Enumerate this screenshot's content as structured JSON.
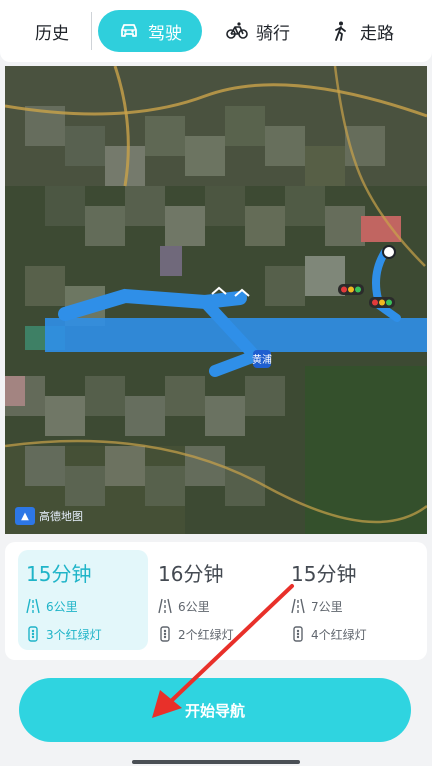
{
  "tabs": {
    "history": "历史",
    "drive": "驾驶",
    "ride": "骑行",
    "walk": "走路"
  },
  "map": {
    "logo_text": "高德地图",
    "road_label": "黄浦"
  },
  "routes": [
    {
      "time": "15分钟",
      "distance": "6公里",
      "lights": "3个红绿灯",
      "selected": true
    },
    {
      "time": "16分钟",
      "distance": "6公里",
      "lights": "2个红绿灯",
      "selected": false
    },
    {
      "time": "15分钟",
      "distance": "7公里",
      "lights": "4个红绿灯",
      "selected": false
    }
  ],
  "actions": {
    "start_navigation": "开始导航"
  },
  "colors": {
    "accent": "#2fcfdc",
    "route_line": "#2f8fe8",
    "annotation_arrow": "#e8302a"
  },
  "icons": {
    "drive": "car-icon",
    "ride": "bicycle-icon",
    "walk": "walk-icon",
    "distance": "road-icon",
    "lights": "traffic-light-icon"
  }
}
